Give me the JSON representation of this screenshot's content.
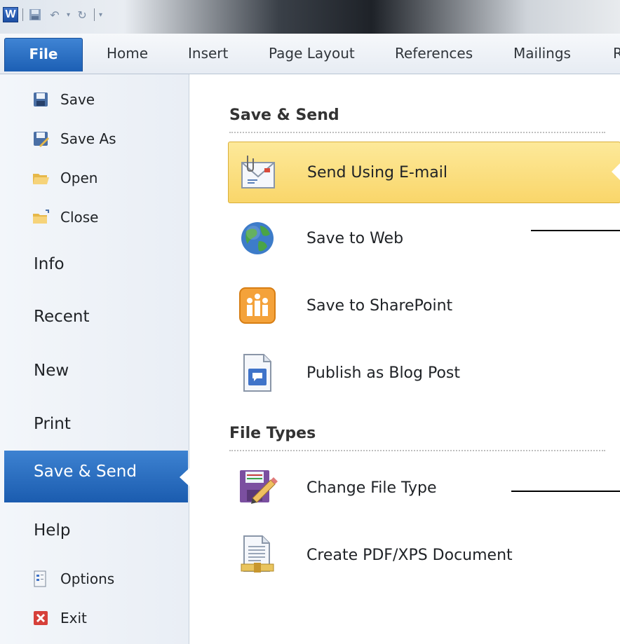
{
  "ribbon": {
    "tabs": [
      "File",
      "Home",
      "Insert",
      "Page Layout",
      "References",
      "Mailings",
      "R"
    ]
  },
  "backstage_nav": {
    "commands": [
      "Save",
      "Save As",
      "Open",
      "Close"
    ],
    "items": [
      "Info",
      "Recent",
      "New",
      "Print",
      "Save & Send",
      "Help"
    ],
    "bottom_commands": [
      "Options",
      "Exit"
    ],
    "active_item": "Save & Send"
  },
  "save_send": {
    "section_title": "Save & Send",
    "items": [
      "Send Using E-mail",
      "Save to Web",
      "Save to SharePoint",
      "Publish as Blog Post"
    ],
    "selected_item": "Send Using E-mail"
  },
  "file_types": {
    "section_title": "File Types",
    "items": [
      "Change File Type",
      "Create PDF/XPS Document"
    ]
  },
  "colors": {
    "accent_blue": "#2a6cc2",
    "selected_gold": "#fbe18a"
  },
  "icons": {
    "word_logo": "word-logo-icon",
    "save": "floppy-disk-icon",
    "save_as": "save-as-icon",
    "open": "folder-open-icon",
    "close": "folder-close-icon",
    "options": "options-icon",
    "exit": "exit-icon",
    "email": "email-envelope-icon",
    "web": "globe-icon",
    "sharepoint": "sharepoint-icon",
    "blog": "blog-post-icon",
    "change_type": "change-file-type-icon",
    "pdf": "pdf-document-icon"
  }
}
